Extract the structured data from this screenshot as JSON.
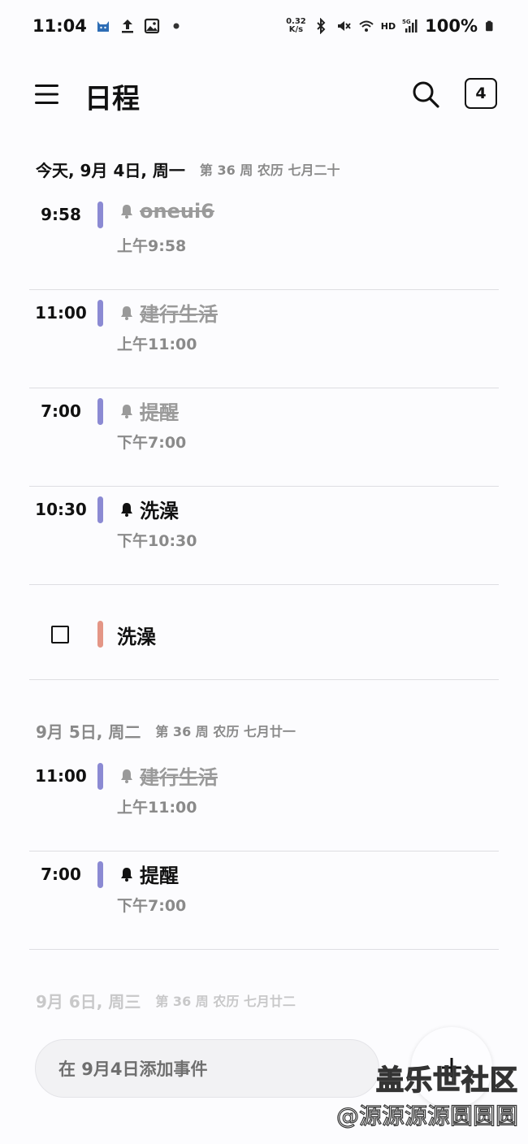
{
  "status_bar": {
    "time": "11:04",
    "net_speed_value": "0.32",
    "net_speed_unit": "K/s",
    "hd_label": "HD",
    "network_label": "5G",
    "battery": "100%",
    "left_icons": [
      "cat-icon",
      "upload-icon",
      "image-icon",
      "dot-icon"
    ],
    "right_icons": [
      "bluetooth-icon",
      "mute-icon",
      "wifi-icon",
      "signal-icon",
      "battery-icon"
    ]
  },
  "app_bar": {
    "title": "日程",
    "today_number": "4"
  },
  "days": [
    {
      "date": "今天, 9月 4日, 周一",
      "meta": "第 36 周  农历 七月二十",
      "events": [
        {
          "time": "9:58",
          "title": "oneui6",
          "sub": "上午9:58",
          "done": true
        },
        {
          "time": "11:00",
          "title": "建行生活",
          "sub": "上午11:00",
          "done": true
        },
        {
          "time": "7:00",
          "title": "提醒",
          "sub": "下午7:00",
          "done": true
        },
        {
          "time": "10:30",
          "title": "洗澡",
          "sub": "下午10:30",
          "done": false
        }
      ],
      "task": {
        "title": "洗澡"
      }
    },
    {
      "date": "9月 5日, 周二",
      "meta": "第 36 周  农历 七月廿一",
      "events": [
        {
          "time": "11:00",
          "title": "建行生活",
          "sub": "上午11:00",
          "done": true
        },
        {
          "time": "7:00",
          "title": "提醒",
          "sub": "下午7:00",
          "done": false
        }
      ]
    },
    {
      "date": "9月 6日, 周三",
      "meta": "第 36 周  农历 七月廿二"
    }
  ],
  "add_event": {
    "placeholder": "在 9月4日添加事件"
  },
  "watermark": {
    "line1": "盖乐世社区",
    "line2": "@源源源源圆圆圆"
  },
  "colors": {
    "event_bar": "#8b8ad3",
    "task_bar": "#e49686",
    "muted_text": "#8a8a8a"
  }
}
